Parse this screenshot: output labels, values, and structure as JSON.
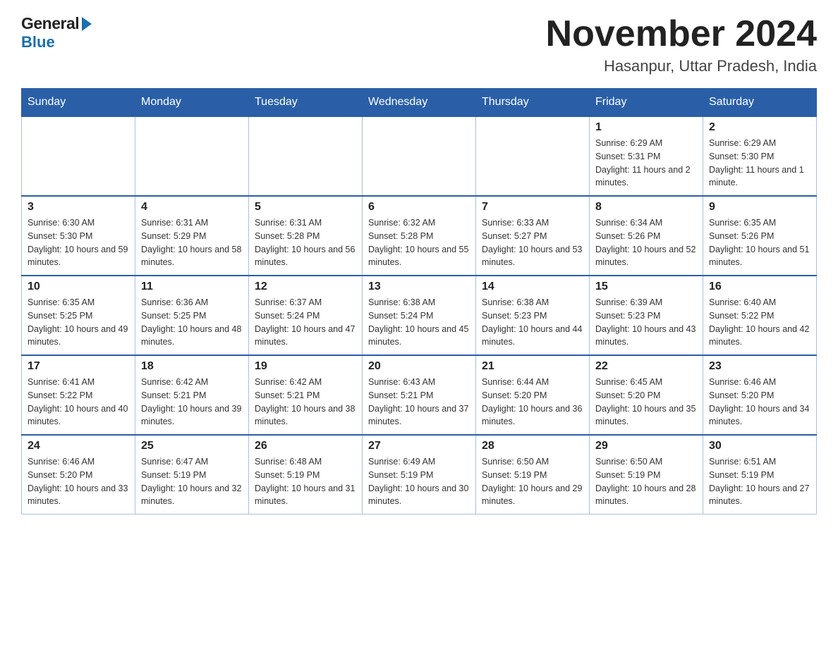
{
  "logo": {
    "general": "General",
    "blue": "Blue"
  },
  "title": "November 2024",
  "subtitle": "Hasanpur, Uttar Pradesh, India",
  "days_of_week": [
    "Sunday",
    "Monday",
    "Tuesday",
    "Wednesday",
    "Thursday",
    "Friday",
    "Saturday"
  ],
  "weeks": [
    [
      {
        "day": "",
        "info": ""
      },
      {
        "day": "",
        "info": ""
      },
      {
        "day": "",
        "info": ""
      },
      {
        "day": "",
        "info": ""
      },
      {
        "day": "",
        "info": ""
      },
      {
        "day": "1",
        "info": "Sunrise: 6:29 AM\nSunset: 5:31 PM\nDaylight: 11 hours and 2 minutes."
      },
      {
        "day": "2",
        "info": "Sunrise: 6:29 AM\nSunset: 5:30 PM\nDaylight: 11 hours and 1 minute."
      }
    ],
    [
      {
        "day": "3",
        "info": "Sunrise: 6:30 AM\nSunset: 5:30 PM\nDaylight: 10 hours and 59 minutes."
      },
      {
        "day": "4",
        "info": "Sunrise: 6:31 AM\nSunset: 5:29 PM\nDaylight: 10 hours and 58 minutes."
      },
      {
        "day": "5",
        "info": "Sunrise: 6:31 AM\nSunset: 5:28 PM\nDaylight: 10 hours and 56 minutes."
      },
      {
        "day": "6",
        "info": "Sunrise: 6:32 AM\nSunset: 5:28 PM\nDaylight: 10 hours and 55 minutes."
      },
      {
        "day": "7",
        "info": "Sunrise: 6:33 AM\nSunset: 5:27 PM\nDaylight: 10 hours and 53 minutes."
      },
      {
        "day": "8",
        "info": "Sunrise: 6:34 AM\nSunset: 5:26 PM\nDaylight: 10 hours and 52 minutes."
      },
      {
        "day": "9",
        "info": "Sunrise: 6:35 AM\nSunset: 5:26 PM\nDaylight: 10 hours and 51 minutes."
      }
    ],
    [
      {
        "day": "10",
        "info": "Sunrise: 6:35 AM\nSunset: 5:25 PM\nDaylight: 10 hours and 49 minutes."
      },
      {
        "day": "11",
        "info": "Sunrise: 6:36 AM\nSunset: 5:25 PM\nDaylight: 10 hours and 48 minutes."
      },
      {
        "day": "12",
        "info": "Sunrise: 6:37 AM\nSunset: 5:24 PM\nDaylight: 10 hours and 47 minutes."
      },
      {
        "day": "13",
        "info": "Sunrise: 6:38 AM\nSunset: 5:24 PM\nDaylight: 10 hours and 45 minutes."
      },
      {
        "day": "14",
        "info": "Sunrise: 6:38 AM\nSunset: 5:23 PM\nDaylight: 10 hours and 44 minutes."
      },
      {
        "day": "15",
        "info": "Sunrise: 6:39 AM\nSunset: 5:23 PM\nDaylight: 10 hours and 43 minutes."
      },
      {
        "day": "16",
        "info": "Sunrise: 6:40 AM\nSunset: 5:22 PM\nDaylight: 10 hours and 42 minutes."
      }
    ],
    [
      {
        "day": "17",
        "info": "Sunrise: 6:41 AM\nSunset: 5:22 PM\nDaylight: 10 hours and 40 minutes."
      },
      {
        "day": "18",
        "info": "Sunrise: 6:42 AM\nSunset: 5:21 PM\nDaylight: 10 hours and 39 minutes."
      },
      {
        "day": "19",
        "info": "Sunrise: 6:42 AM\nSunset: 5:21 PM\nDaylight: 10 hours and 38 minutes."
      },
      {
        "day": "20",
        "info": "Sunrise: 6:43 AM\nSunset: 5:21 PM\nDaylight: 10 hours and 37 minutes."
      },
      {
        "day": "21",
        "info": "Sunrise: 6:44 AM\nSunset: 5:20 PM\nDaylight: 10 hours and 36 minutes."
      },
      {
        "day": "22",
        "info": "Sunrise: 6:45 AM\nSunset: 5:20 PM\nDaylight: 10 hours and 35 minutes."
      },
      {
        "day": "23",
        "info": "Sunrise: 6:46 AM\nSunset: 5:20 PM\nDaylight: 10 hours and 34 minutes."
      }
    ],
    [
      {
        "day": "24",
        "info": "Sunrise: 6:46 AM\nSunset: 5:20 PM\nDaylight: 10 hours and 33 minutes."
      },
      {
        "day": "25",
        "info": "Sunrise: 6:47 AM\nSunset: 5:19 PM\nDaylight: 10 hours and 32 minutes."
      },
      {
        "day": "26",
        "info": "Sunrise: 6:48 AM\nSunset: 5:19 PM\nDaylight: 10 hours and 31 minutes."
      },
      {
        "day": "27",
        "info": "Sunrise: 6:49 AM\nSunset: 5:19 PM\nDaylight: 10 hours and 30 minutes."
      },
      {
        "day": "28",
        "info": "Sunrise: 6:50 AM\nSunset: 5:19 PM\nDaylight: 10 hours and 29 minutes."
      },
      {
        "day": "29",
        "info": "Sunrise: 6:50 AM\nSunset: 5:19 PM\nDaylight: 10 hours and 28 minutes."
      },
      {
        "day": "30",
        "info": "Sunrise: 6:51 AM\nSunset: 5:19 PM\nDaylight: 10 hours and 27 minutes."
      }
    ]
  ]
}
